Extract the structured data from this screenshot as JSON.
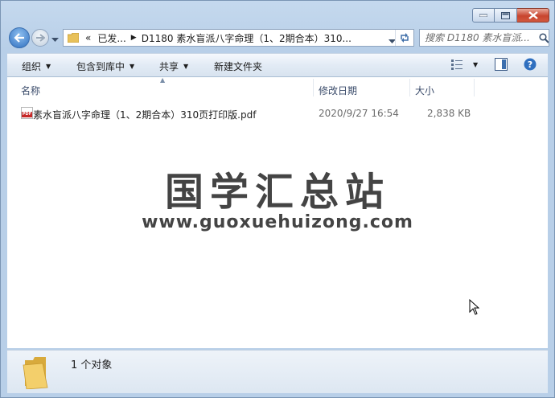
{
  "window": {
    "breadcrumb": {
      "overflow": "«",
      "parent": "已发...",
      "current": "D1180 素水盲派八字命理（1、2期合本）310..."
    },
    "search": {
      "placeholder": "搜索 D1180 素水盲派..."
    }
  },
  "toolbar": {
    "organize": "组织",
    "include_in_library": "包含到库中",
    "share": "共享",
    "new_folder": "新建文件夹"
  },
  "columns": {
    "name": "名称",
    "date_modified": "修改日期",
    "size": "大小"
  },
  "files": [
    {
      "name": "素水盲派八字命理（1、2期合本）310页打印版.pdf",
      "date_modified": "2020/9/27 16:54",
      "size": "2,838 KB",
      "icon": "pdf-file-icon",
      "icon_text": "PDF"
    }
  ],
  "watermark": {
    "title": "国学汇总站",
    "url": "www.guoxuehuizong.com"
  },
  "details": {
    "count": "1 个对象"
  },
  "colors": {
    "accent": "#2f6fbf",
    "close": "#c8452f",
    "pdf": "#c62828"
  }
}
